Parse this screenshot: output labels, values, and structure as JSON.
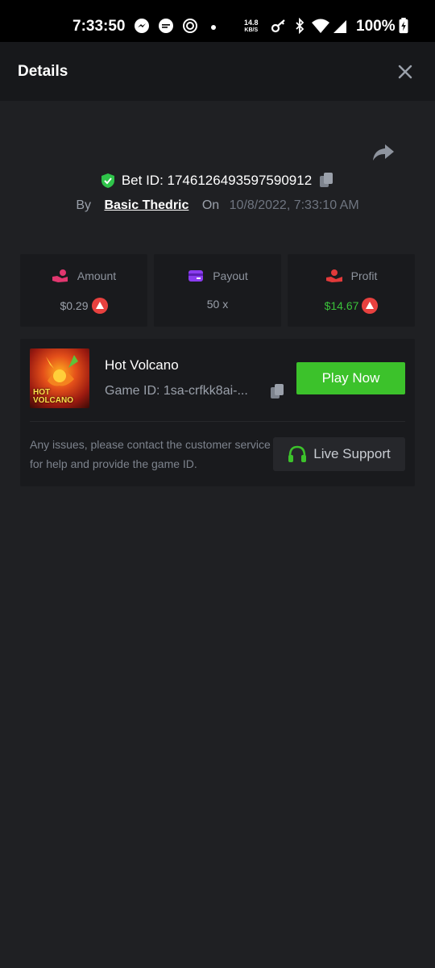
{
  "status_bar": {
    "time": "7:33:50",
    "net_speed_value": "14.8",
    "net_speed_unit": "KB/S",
    "battery": "100%"
  },
  "header": {
    "title": "Details"
  },
  "bet": {
    "id_label": "Bet ID: 1746126493597590912",
    "by_label": "By",
    "user": "Basic Thedric",
    "on_label": "On",
    "date": "10/8/2022, 7:33:10 AM"
  },
  "stats": {
    "amount": {
      "label": "Amount",
      "value": "$0.29"
    },
    "payout": {
      "label": "Payout",
      "value": "50 x"
    },
    "profit": {
      "label": "Profit",
      "value": "$14.67"
    }
  },
  "game": {
    "title": "Hot Volcano",
    "game_id": "Game ID: 1sa-crfkk8ai-...",
    "thumb_text_1": "HOT",
    "thumb_text_2": "VOLCANO",
    "play_label": "Play Now",
    "help_text": "Any issues, please contact the customer service for help and provide the game ID.",
    "support_label": "Live Support"
  },
  "colors": {
    "accent_green": "#3cc22b",
    "profit_green": "#3ac13a",
    "coin_red": "#e8413f",
    "amount_pink": "#e2376f",
    "payout_purple": "#8b3cf0",
    "profit_red": "#e23a3a",
    "shield_green": "#2fc44a"
  }
}
